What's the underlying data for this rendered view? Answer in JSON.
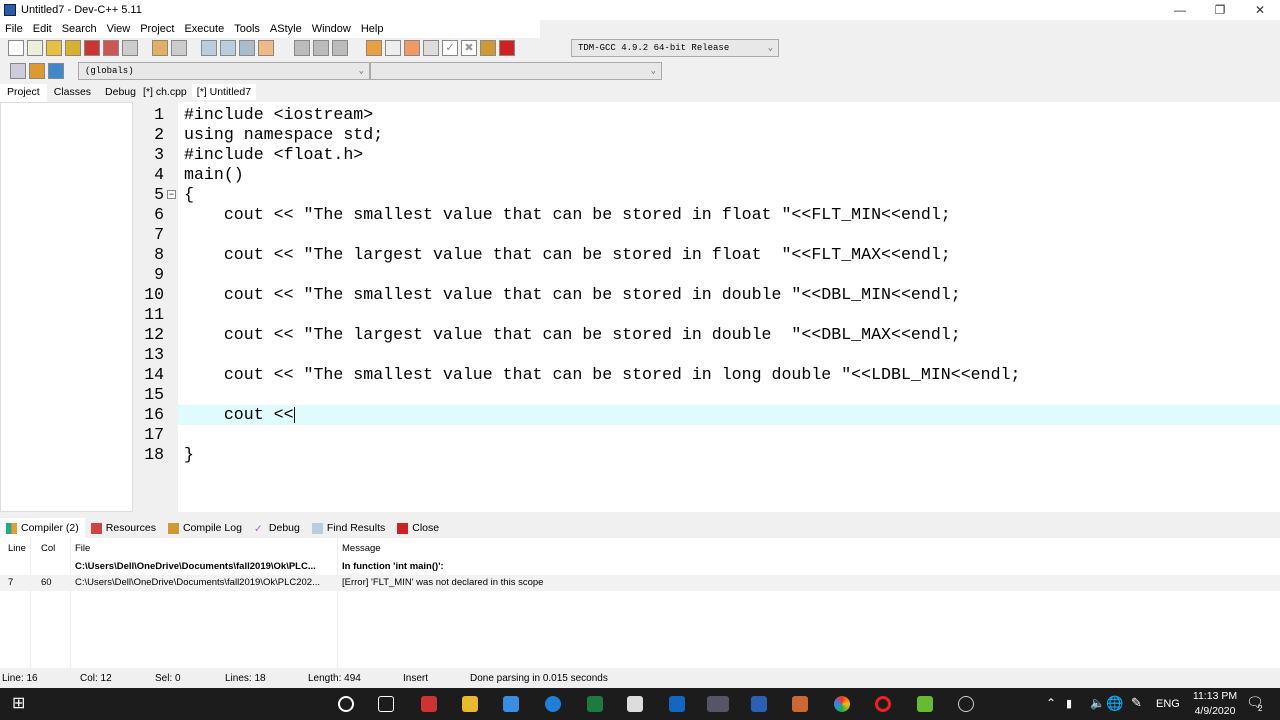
{
  "window": {
    "title": "Untitled7 - Dev-C++ 5.11"
  },
  "menu": [
    "File",
    "Edit",
    "Search",
    "View",
    "Project",
    "Execute",
    "Tools",
    "AStyle",
    "Window",
    "Help"
  ],
  "toolbar": {
    "compiler": "TDM-GCC 4.9.2 64-bit Release",
    "scope": "(globals)",
    "member": ""
  },
  "left_tabs": [
    "Project",
    "Classes",
    "Debug"
  ],
  "file_tabs": [
    "[*] ch.cpp",
    "[*] Untitled7"
  ],
  "editor": {
    "current_line": 16,
    "lines": [
      "#include <iostream>",
      "using namespace std;",
      "#include <float.h>",
      "main()",
      "{",
      "    cout << \"The smallest value that can be stored in float \"<<FLT_MIN<<endl;",
      "",
      "    cout << \"The largest value that can be stored in float  \"<<FLT_MAX<<endl;",
      "",
      "    cout << \"The smallest value that can be stored in double \"<<DBL_MIN<<endl;",
      "",
      "    cout << \"The largest value that can be stored in double  \"<<DBL_MAX<<endl;",
      "",
      "    cout << \"The smallest value that can be stored in long double \"<<LDBL_MIN<<endl;",
      "",
      "    cout <<",
      "",
      "}"
    ]
  },
  "bottom_tabs": [
    "Compiler (2)",
    "Resources",
    "Compile Log",
    "Debug",
    "Find Results",
    "Close"
  ],
  "messages": {
    "columns": [
      "Line",
      "Col",
      "File",
      "Message"
    ],
    "rows": [
      {
        "line": "",
        "col": "",
        "file": "C:\\Users\\Dell\\OneDrive\\Documents\\fall2019\\Ok\\PLC...",
        "message": "In function 'int main()':"
      },
      {
        "line": "7",
        "col": "60",
        "file": "C:\\Users\\Dell\\OneDrive\\Documents\\fall2019\\Ok\\PLC202...",
        "message": "[Error] 'FLT_MIN' was not declared in this scope"
      }
    ]
  },
  "status": {
    "line": "Line:   16",
    "col": "Col:   12",
    "sel": "Sel:   0",
    "lines": "Lines:   18",
    "length": "Length:  494",
    "mode": "Insert",
    "parse": "Done parsing in 0.015 seconds"
  },
  "taskbar": {
    "lang": "ENG",
    "time": "11:13 PM",
    "date": "4/9/2020",
    "notifications": "2"
  }
}
